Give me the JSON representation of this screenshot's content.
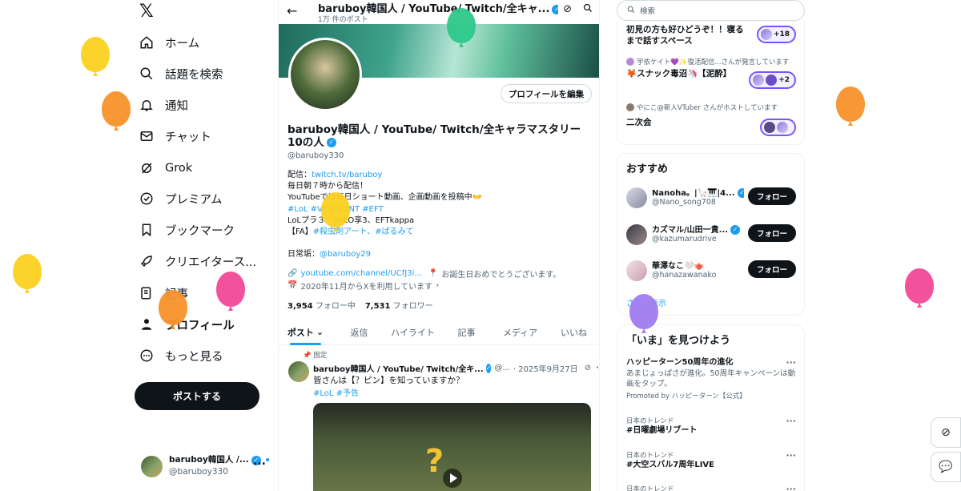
{
  "nav": {
    "logo": "𝕏",
    "items": [
      {
        "label": "ホーム",
        "icon": "home-icon"
      },
      {
        "label": "話題を検索",
        "icon": "search-icon"
      },
      {
        "label": "通知",
        "icon": "bell-icon"
      },
      {
        "label": "チャット",
        "icon": "mail-icon"
      },
      {
        "label": "Grok",
        "icon": "grok-icon"
      },
      {
        "label": "プレミアム",
        "icon": "verified-icon"
      },
      {
        "label": "ブックマーク",
        "icon": "bookmark-icon"
      },
      {
        "label": "クリエイタース...",
        "icon": "rocket-icon"
      },
      {
        "label": "記事",
        "icon": "article-icon"
      },
      {
        "label": "プロフィール",
        "icon": "person-icon"
      },
      {
        "label": "もっと見る",
        "icon": "more-icon"
      }
    ],
    "post_button": "ポストする",
    "account": {
      "name": "baruboy韓国人 /...",
      "handle": "@baruboy330",
      "more": "..."
    }
  },
  "profile": {
    "top_title": "baruboy韓国人 / YouTube/ Twitch/全キャ...",
    "top_subtitle": "1万 件のポスト",
    "edit_button": "プロフィールを編集",
    "name": "baruboy韓国人 / YouTube/ Twitch/全キャラマスタリー10の人",
    "handle": "@baruboy330",
    "bio": {
      "line1_prefix": "配信：",
      "line1_link": "twitch.tv/baruboy",
      "line2": "毎日朝７時から配信！",
      "line3": "YouTubeでは毎日ショート動画、企画動画を投稿中👐",
      "line4": "#LoL #VALORANT #EFT",
      "line5": "LoLプラ３、VALO享3、EFTkappa",
      "line6_prefix": "【FA】",
      "line6_link": "#殺虫剤アート、#ばるみて",
      "line7_prefix": "日常垢：",
      "line7_link": "@baruboy29"
    },
    "website": "youtube.com/channel/UCfJ3i...",
    "birthday": "お誕生日おめでとうございます。",
    "joined": "2020年11月からXを利用しています",
    "following_count": "3,954",
    "following_label": "フォロー中",
    "followers_count": "7,531",
    "followers_label": "フォロワー",
    "tabs": [
      "ポスト",
      "返信",
      "ハイライト",
      "記事",
      "メディア",
      "いいね"
    ]
  },
  "tweet": {
    "pinned": "固定",
    "name": "baruboy韓国人 / YouTube/ Twitch/全キ...",
    "handle": "@...",
    "date": "· 2025年9月27日",
    "text": "皆さんは【？ピン】を知っていますか？",
    "tags": "#LoL #予告",
    "media_glyph": "?"
  },
  "right": {
    "search_placeholder": "検索",
    "spaces": [
      {
        "host": "",
        "title": "初見の方も好ひどうぞ！！寝るまで話すスペース",
        "count": "+18"
      },
      {
        "host": "宇依ケイト💜✨復活配信...さんが発言しています",
        "title": "🦊スナック毒沼🦄【泥酔】",
        "count": "+2"
      },
      {
        "host": "やにこ@新人VTuber さんがホストしています",
        "title": "二次会",
        "count": ""
      }
    ],
    "recommend_title": "おすすめ",
    "recommend": [
      {
        "name": "Nanoha。|🦙🎹|4...",
        "handle": "@Nano_song708",
        "button": "フォロー"
      },
      {
        "name": "カズマル/山田一貴...",
        "handle": "@kazumarudrive",
        "button": "フォロー"
      },
      {
        "name": "華澤なこ🤍🫖",
        "handle": "@hanazawanako",
        "button": "フォロー"
      }
    ],
    "show_more": "さらに表示",
    "trends_title": "「いま」を見つけよう",
    "trends": [
      {
        "context": "",
        "title": "ハッピーターン50周年の進化",
        "desc": "あまじょっぱさが進化。50周年キャンペーンは動画をタップ。",
        "promo": "Promoted by ハッピーターン【公式】"
      },
      {
        "context": "日本のトレンド",
        "title": "#日曜劇場リブート",
        "desc": "",
        "promo": ""
      },
      {
        "context": "日本のトレンド",
        "title": "#大空スバル7周年LIVE",
        "desc": "",
        "promo": ""
      },
      {
        "context": "日本のトレンド",
        "title": "",
        "desc": "",
        "promo": ""
      }
    ]
  },
  "colors": {
    "accent": "#1d9bf0",
    "text": "#0f1419",
    "muted": "#536471",
    "space_purple": "#7856ff"
  }
}
